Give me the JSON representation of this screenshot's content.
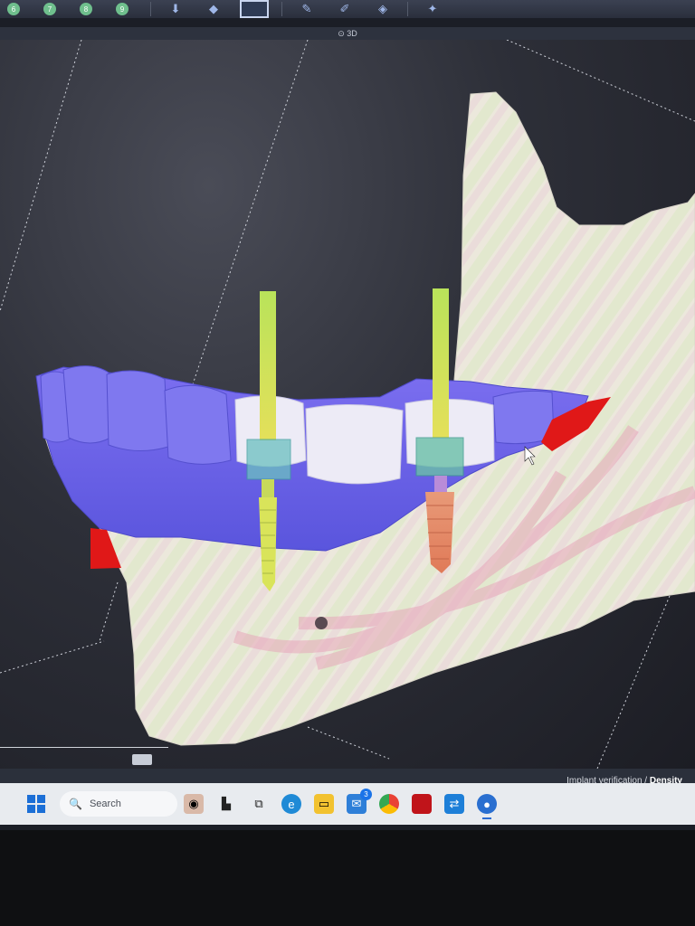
{
  "toolbar": {
    "numbered_buttons": [
      "6",
      "7",
      "8",
      "9"
    ],
    "tools": [
      "implant-tool",
      "scan-tool",
      "select-tool",
      "layers-tool",
      "measure-tool",
      "sculpt-tool",
      "cursor-tool",
      "bone-tool"
    ]
  },
  "view": {
    "label": "3D"
  },
  "status": {
    "verification_label": "Implant verification",
    "mode_label": "Density"
  },
  "taskbar": {
    "search_placeholder": "Search",
    "mail_badge": "3",
    "apps": [
      "eye-app-icon",
      "task-view-icon",
      "snip-icon",
      "edge-icon",
      "file-explorer-icon",
      "mail-icon",
      "chrome-icon",
      "red-app-icon",
      "remote-app-icon",
      "blue-app-icon"
    ]
  },
  "colors": {
    "bone": "#ece9df",
    "gums": "#6d68e6",
    "crown": "#eceaf5",
    "implant_yellow": "#d6e85a",
    "implant_orange": "#e88a6a",
    "nerve": "#e8a8b8",
    "red_marker": "#e01818"
  }
}
